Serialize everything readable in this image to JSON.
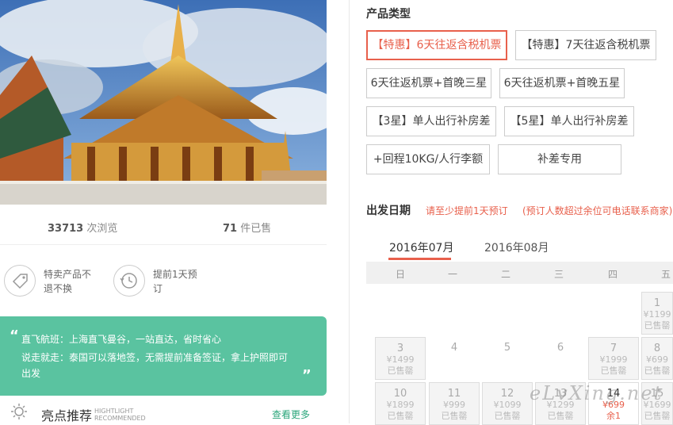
{
  "stats": {
    "views_num": "33713",
    "views_label": "次浏览",
    "sold_num": "71",
    "sold_label": "件已售"
  },
  "features": [
    {
      "text1": "特卖产品不",
      "text2": "退不换",
      "icon": "tag-icon"
    },
    {
      "text1": "提前1天预",
      "text2": "订",
      "icon": "history-clock-icon"
    }
  ],
  "highlight_box": {
    "line1": "直飞航班：上海直飞曼谷，一站直达，省时省心",
    "line2": "说走就走：泰国可以落地签，无需提前准备签证，拿上护照即可出发"
  },
  "highlights": {
    "title": "亮点推荐",
    "sub1": "HIGHTLIGHT",
    "sub2": "RECOMMENDED",
    "more": "查看更多"
  },
  "product_type": {
    "title": "产品类型",
    "options": [
      "【特惠】6天往返含税机票",
      "【特惠】7天往返含税机票",
      "6天往返机票+首晚三星",
      "6天往返机票+首晚五星",
      "【3星】单人出行补房差",
      "【5星】单人出行补房差",
      "+回程10KG/人行李额",
      "补差专用"
    ]
  },
  "departure": {
    "title": "出发日期",
    "note1": "请至少提前1天预订",
    "note2": "(预订人数超过余位可电话联系商家)",
    "months": [
      "2016年07月",
      "2016年08月"
    ],
    "weekdays": [
      "日",
      "一",
      "二",
      "三",
      "四",
      "五"
    ],
    "cells": [
      {
        "day": "1",
        "price": "¥1199",
        "status": "已售罄"
      },
      {
        "day": "3",
        "price": "¥1499",
        "status": "已售罄"
      },
      {
        "day": "4"
      },
      {
        "day": "5"
      },
      {
        "day": "6"
      },
      {
        "day": "7",
        "price": "¥1999",
        "status": "已售罄"
      },
      {
        "day": "8",
        "price": "¥699",
        "status": "已售罄"
      },
      {
        "day": "10",
        "price": "¥1899",
        "status": "已售罄"
      },
      {
        "day": "11",
        "price": "¥999",
        "status": "已售罄"
      },
      {
        "day": "12",
        "price": "¥1099",
        "status": "已售罄"
      },
      {
        "day": "13",
        "price": "¥1299",
        "status": "已售罄"
      },
      {
        "day": "14",
        "price": "¥699",
        "status": "余1"
      },
      {
        "day": "15",
        "price": "¥1699",
        "status": "已售罄"
      }
    ]
  },
  "watermark": "eLvXing.net",
  "colors": {
    "accent": "#e8604c",
    "green": "#5ac3a0"
  }
}
